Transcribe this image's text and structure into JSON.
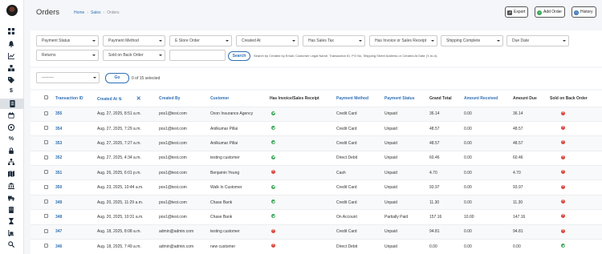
{
  "header": {
    "title": "Orders",
    "breadcrumb": [
      "Home",
      "Sales",
      "Orders"
    ],
    "export_label": "Export",
    "add_order_label": "Add Order",
    "history_label": "History"
  },
  "filters": {
    "payment_status": "Payment Status",
    "payment_method": "Payment Method",
    "estore_order": "E Store Order",
    "created_at": "Created At",
    "has_sales_tax": "Has Sales Tax",
    "has_invoice": "Has Invoice or Sales Receipt",
    "shipping_complete": "Shipping Complete",
    "due_date": "Due Date",
    "returns": "Returns",
    "sold_on_back_order": "Sold on Back Order",
    "search_value": "",
    "search_label": "Search",
    "search_hint": "Search by Created by Email, Customer Legal Name, Transaction ID, PO No, Shipping Street Address or Created At Date (Y-m-d)."
  },
  "bulk": {
    "action_value": "---------",
    "go_label": "Go",
    "selected_text": "0 of 15 selected"
  },
  "table": {
    "columns": [
      "Transaction ID",
      "Created At",
      "Created By",
      "Customer",
      "Has Invoice/Sales Receipt",
      "Payment Method",
      "Payment Status",
      "Grand Total",
      "Amount Received",
      "Amount Due",
      "Sold on Back Order"
    ],
    "sort_indicator": "⇅",
    "clear_sort": "✕",
    "rows": [
      {
        "id": "355",
        "created": "Aug. 27, 2025, 8:51 a.m.",
        "by": "pos1@test.com",
        "customer": "Oxon Insurance Agency",
        "invoice": true,
        "method": "Credit Card",
        "status": "Unpaid",
        "total": "36.14",
        "received": "0.00",
        "due": "36.14",
        "backorder": false
      },
      {
        "id": "354",
        "created": "Aug. 27, 2025, 7:29 a.m.",
        "by": "pos1@test.com",
        "customer": "Anilkumar Pillai",
        "invoice": true,
        "method": "Credit Card",
        "status": "Unpaid",
        "total": "48.57",
        "received": "0.00",
        "due": "48.57",
        "backorder": false
      },
      {
        "id": "353",
        "created": "Aug. 27, 2025, 7:27 a.m.",
        "by": "pos1@test.com",
        "customer": "Anilkumar Pillai",
        "invoice": true,
        "method": "Credit Card",
        "status": "Unpaid",
        "total": "48.57",
        "received": "0.00",
        "due": "48.57",
        "backorder": false
      },
      {
        "id": "352",
        "created": "Aug. 27, 2025, 4:34 a.m.",
        "by": "pos1@test.com",
        "customer": "testing customer",
        "invoice": true,
        "method": "Direct Debit",
        "status": "Unpaid",
        "total": "60.46",
        "received": "0.00",
        "due": "60.46",
        "backorder": false
      },
      {
        "id": "351",
        "created": "Aug. 26, 2025, 6:01 p.m.",
        "by": "pos1@test.com",
        "customer": "Benjamin Yeung",
        "invoice": false,
        "method": "Cash",
        "status": "Unpaid",
        "total": "4.70",
        "received": "0.00",
        "due": "4.70",
        "backorder": false
      },
      {
        "id": "350",
        "created": "Aug. 23, 2025, 10:44 a.m.",
        "by": "pos1@test.com",
        "customer": "Walk In Customer",
        "invoice": true,
        "method": "Credit Card",
        "status": "Unpaid",
        "total": "93.97",
        "received": "0.00",
        "due": "93.97",
        "backorder": false
      },
      {
        "id": "349",
        "created": "Aug. 20, 2025, 11:29 a.m.",
        "by": "pos1@test.com",
        "customer": "Chase Bank",
        "invoice": true,
        "method": "Credit Card",
        "status": "Unpaid",
        "total": "11.30",
        "received": "0.00",
        "due": "11.30",
        "backorder": false
      },
      {
        "id": "348",
        "created": "Aug. 20, 2025, 10:31 a.m.",
        "by": "pos1@test.com",
        "customer": "Chase Bank",
        "invoice": true,
        "method": "On Account",
        "status": "Partially Paid",
        "total": "157.16",
        "received": "10.00",
        "due": "147.16",
        "backorder": false
      },
      {
        "id": "347",
        "created": "Aug. 18, 2025, 8:08 a.m.",
        "by": "admin@admin.com",
        "customer": "testing customer",
        "invoice": false,
        "method": "Credit Card",
        "status": "Unpaid",
        "total": "94.81",
        "received": "0.00",
        "due": "94.81",
        "backorder": false
      },
      {
        "id": "346",
        "created": "Aug. 18, 2025, 7:49 a.m.",
        "by": "admin@admin.com",
        "customer": "new customer",
        "invoice": false,
        "method": "Direct Debit",
        "status": "Unpaid",
        "total": "0.00",
        "received": "0.00",
        "due": "0.00",
        "backorder": true
      }
    ]
  },
  "colors": {
    "accent": "#2f6fb5",
    "success": "#3aa657",
    "danger": "#d9453b",
    "sidebar_active": "#dde1e6"
  }
}
